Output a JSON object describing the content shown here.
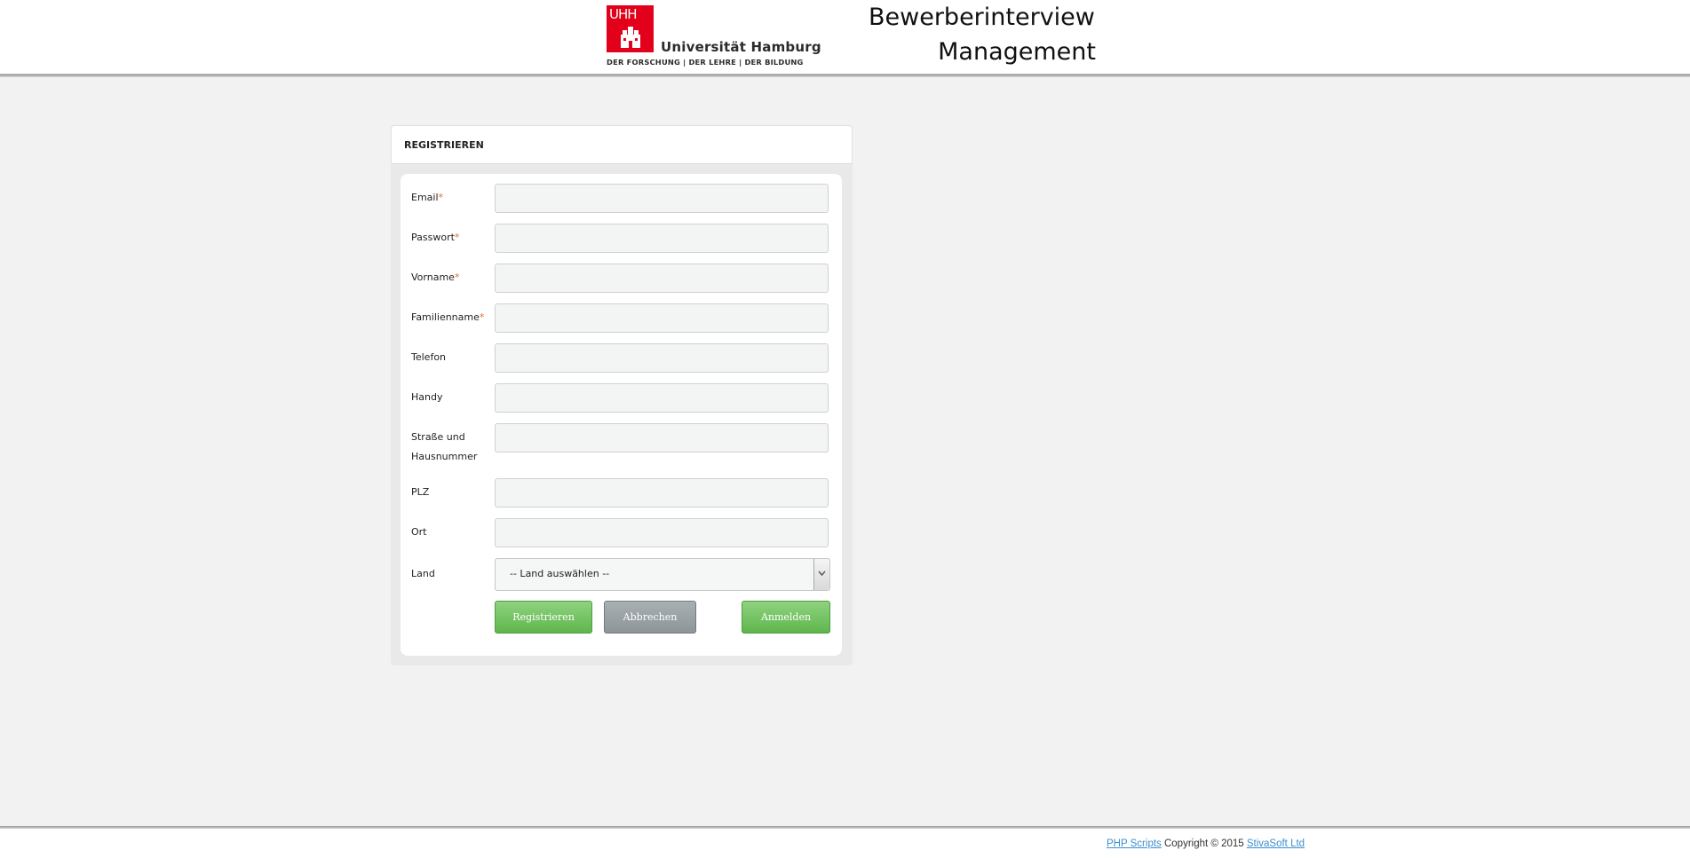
{
  "header": {
    "logo_mark": "UHH",
    "logo_name": "Universität Hamburg",
    "logo_tagline": "DER FORSCHUNG | DER LEHRE | DER BILDUNG",
    "title_line1": "Bewerberinterview",
    "title_line2": "Management"
  },
  "form": {
    "title": "REGISTRIEREN",
    "required_marker": "*",
    "fields": [
      {
        "label": "Email",
        "required": true,
        "value": ""
      },
      {
        "label": "Passwort",
        "required": true,
        "value": ""
      },
      {
        "label": "Vorname",
        "required": true,
        "value": ""
      },
      {
        "label": "Familienname",
        "required": true,
        "value": ""
      },
      {
        "label": "Telefon",
        "required": false,
        "value": ""
      },
      {
        "label": "Handy",
        "required": false,
        "value": ""
      },
      {
        "label": "Straße und Hausnummer",
        "required": false,
        "value": ""
      },
      {
        "label": "PLZ",
        "required": false,
        "value": ""
      },
      {
        "label": "Ort",
        "required": false,
        "value": ""
      }
    ],
    "country": {
      "label": "Land",
      "selected": "-- Land auswählen --"
    },
    "buttons": {
      "register": "Registrieren",
      "cancel": "Abbrechen",
      "login": "Anmelden"
    }
  },
  "footer": {
    "link1": "PHP Scripts",
    "copyright": "Copyright © 2015",
    "link2": "StivaSoft Ltd"
  },
  "colors": {
    "brand_red": "#e2001a",
    "button_green": "#6cbf5a",
    "button_gray": "#9aa1a4",
    "link_blue": "#3a8fcf",
    "required_orange": "#e07020"
  }
}
